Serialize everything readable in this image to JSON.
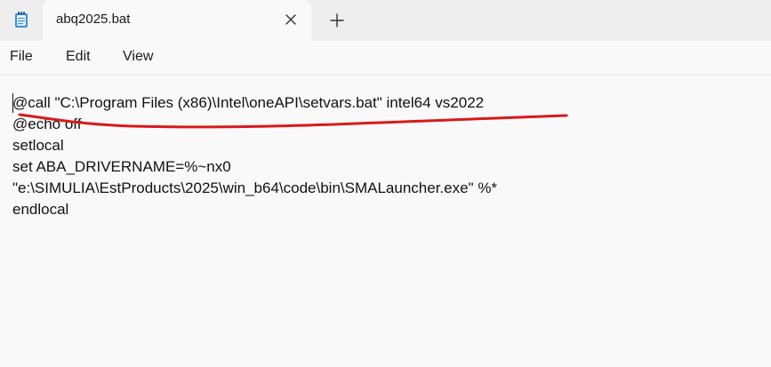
{
  "tab": {
    "title": "abq2025.bat",
    "close_icon": "close-icon",
    "new_tab_icon": "plus-icon"
  },
  "app_icon": "notepad-icon",
  "menu": {
    "file": "File",
    "edit": "Edit",
    "view": "View"
  },
  "editor": {
    "lines": [
      "@call \"C:\\Program Files (x86)\\Intel\\oneAPI\\setvars.bat\" intel64 vs2022",
      "@echo off",
      "setlocal",
      "set ABA_DRIVERNAME=%~nx0",
      "\"e:\\SIMULIA\\EstProducts\\2025\\win_b64\\code\\bin\\SMALauncher.exe\" %*",
      "endlocal"
    ]
  },
  "annotation": {
    "color": "#d9191b"
  }
}
